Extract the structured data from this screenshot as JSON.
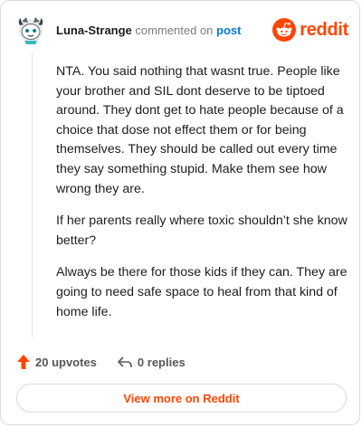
{
  "header": {
    "username": "Luna-Strange",
    "action_text": "commented on",
    "post_link_label": "post",
    "brand_name": "reddit"
  },
  "comment": {
    "paragraphs": [
      "NTA. You said nothing that wasnt true. People like your brother and SIL dont deserve to be tiptoed around. They dont get to hate people because of a choice that dose not effect them or for being themselves. They should be called out every time they say something stupid. Make them see how wrong they are.",
      "If her parents really where toxic shouldn’t she know better?",
      "Always be there for those kids if they can. They are going to need safe space to heal from that kind of home life."
    ]
  },
  "actions": {
    "upvotes_label": "20 upvotes",
    "replies_label": "0 replies"
  },
  "view_more_label": "View more on Reddit",
  "icons": {
    "avatar": "snoo-avatar",
    "brand": "reddit-logo-icon",
    "upvote": "upvote-arrow-icon",
    "reply": "reply-arrow-icon"
  },
  "colors": {
    "brand": "#ff4500",
    "link": "#0079d3",
    "text": "#1c1c1c",
    "muted": "#7c7c7c"
  }
}
